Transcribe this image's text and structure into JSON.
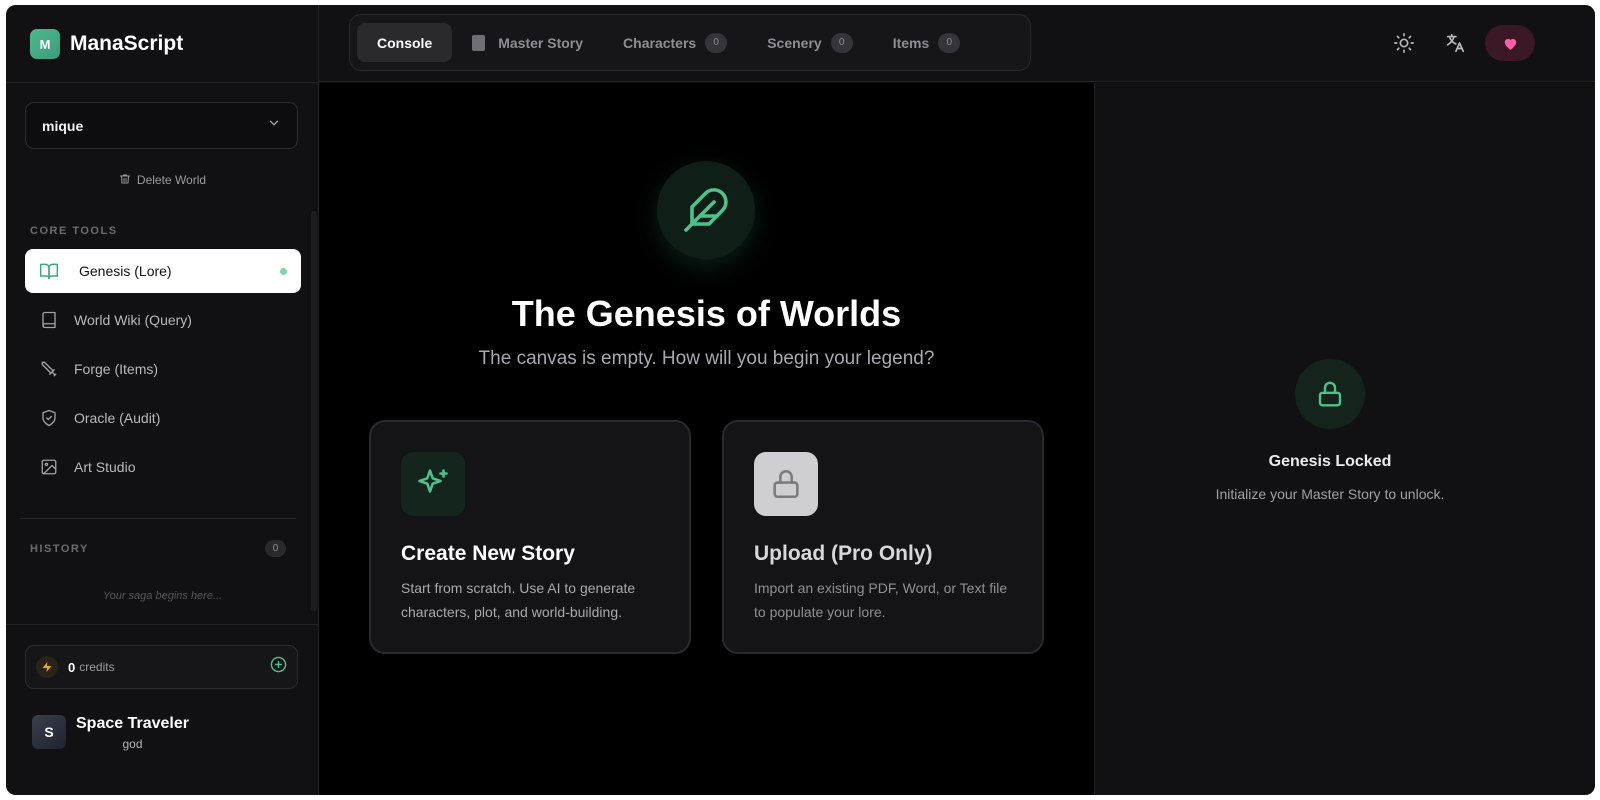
{
  "brand": {
    "logo_letter": "M",
    "name": "ManaScript"
  },
  "world": {
    "selected": "mique",
    "delete_label": "Delete World"
  },
  "sidebar": {
    "core_label": "CORE TOOLS",
    "items": [
      {
        "label": "Genesis (Lore)",
        "icon": "book-open-icon",
        "active": true
      },
      {
        "label": "World Wiki (Query)",
        "icon": "book-icon"
      },
      {
        "label": "Forge (Items)",
        "icon": "sword-icon"
      },
      {
        "label": "Oracle (Audit)",
        "icon": "shield-icon"
      },
      {
        "label": "Art Studio",
        "icon": "image-icon"
      }
    ],
    "history_label": "HISTORY",
    "history_count": "0",
    "history_empty": "Your saga begins here..."
  },
  "credits": {
    "value": "0",
    "label": "credits"
  },
  "user": {
    "initial": "S",
    "name": "Space Traveler",
    "role": "god"
  },
  "tabs": [
    {
      "label": "Console",
      "active": true
    },
    {
      "label": "Master Story"
    },
    {
      "label": "Characters",
      "count": "0"
    },
    {
      "label": "Scenery",
      "count": "0"
    },
    {
      "label": "Items",
      "count": "0"
    }
  ],
  "hero": {
    "title": "The Genesis of Worlds",
    "subtitle": "The canvas is empty. How will you begin your legend?"
  },
  "cards": [
    {
      "title": "Create New Story",
      "desc": "Start from scratch. Use AI to generate characters, plot, and world-building.",
      "icon": "sparkles-icon"
    },
    {
      "title": "Upload (Pro Only)",
      "desc": "Import an existing PDF, Word, or Text file to populate your lore.",
      "icon": "lock-icon"
    }
  ],
  "locked": {
    "title": "Genesis Locked",
    "subtitle": "Initialize your Master Story to unlock."
  },
  "colors": {
    "accent": "#4fc18d",
    "heart": "#ff5fa2",
    "background": "#000000"
  }
}
